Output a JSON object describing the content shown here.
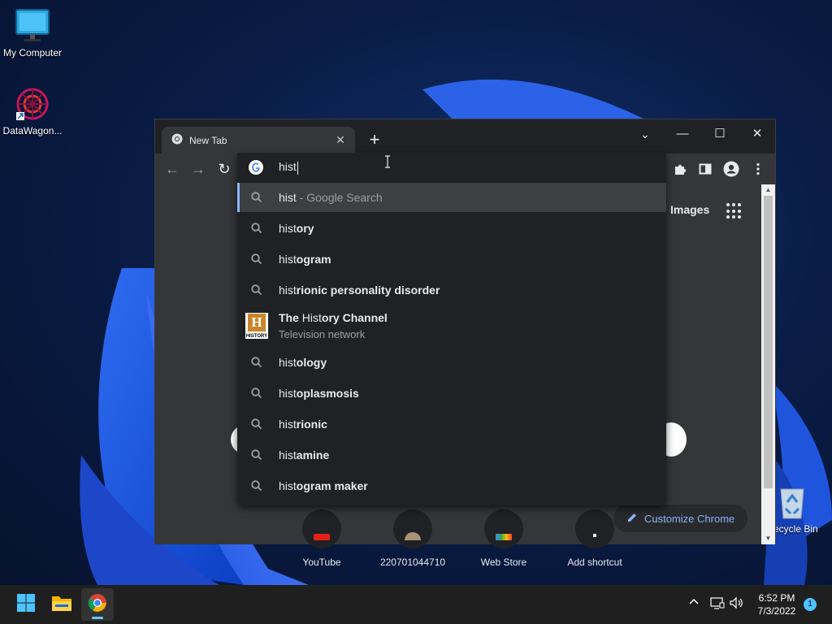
{
  "desktop": {
    "icons": [
      {
        "label": "My Computer"
      },
      {
        "label": "DataWagon..."
      },
      {
        "label": "Recycle Bin"
      }
    ]
  },
  "browser": {
    "tab": {
      "title": "New Tab",
      "close": "✕"
    },
    "new_tab": "+",
    "window_controls": {
      "dropdown": "⌄",
      "minimize": "—",
      "maximize": "☐",
      "close": "✕"
    },
    "omnibox": {
      "value": "hist",
      "suggestions": [
        {
          "prefix": "hist",
          "rest": "",
          "desc": " - Google Search",
          "icon": "search-icon",
          "selected": true
        },
        {
          "prefix": "hist",
          "rest": "ory",
          "icon": "search-icon"
        },
        {
          "prefix": "hist",
          "rest": "ogram",
          "icon": "search-icon"
        },
        {
          "prefix": "hist",
          "rest": "rionic personality disorder",
          "icon": "search-icon"
        },
        {
          "before": "The ",
          "prefix": "Hist",
          "rest": "ory Channel",
          "sub": "Television network",
          "icon": "history-channel-logo"
        },
        {
          "prefix": "hist",
          "rest": "ology",
          "icon": "search-icon"
        },
        {
          "prefix": "hist",
          "rest": "oplasmosis",
          "icon": "search-icon"
        },
        {
          "prefix": "hist",
          "rest": "rionic",
          "icon": "search-icon"
        },
        {
          "prefix": "hist",
          "rest": "amine",
          "icon": "search-icon"
        },
        {
          "prefix": "hist",
          "rest": "ogram maker",
          "icon": "search-icon"
        }
      ],
      "logo_letter": "H",
      "logo_word": "HISTORY"
    },
    "ntp": {
      "images_link": "Images",
      "shortcuts": [
        {
          "label": "YouTube"
        },
        {
          "label": "220701044710"
        },
        {
          "label": "Web Store"
        },
        {
          "label": "Add shortcut"
        }
      ],
      "customize": "Customize Chrome"
    }
  },
  "taskbar": {
    "time": "6:52 PM",
    "date": "7/3/2022",
    "notifications": "1"
  }
}
